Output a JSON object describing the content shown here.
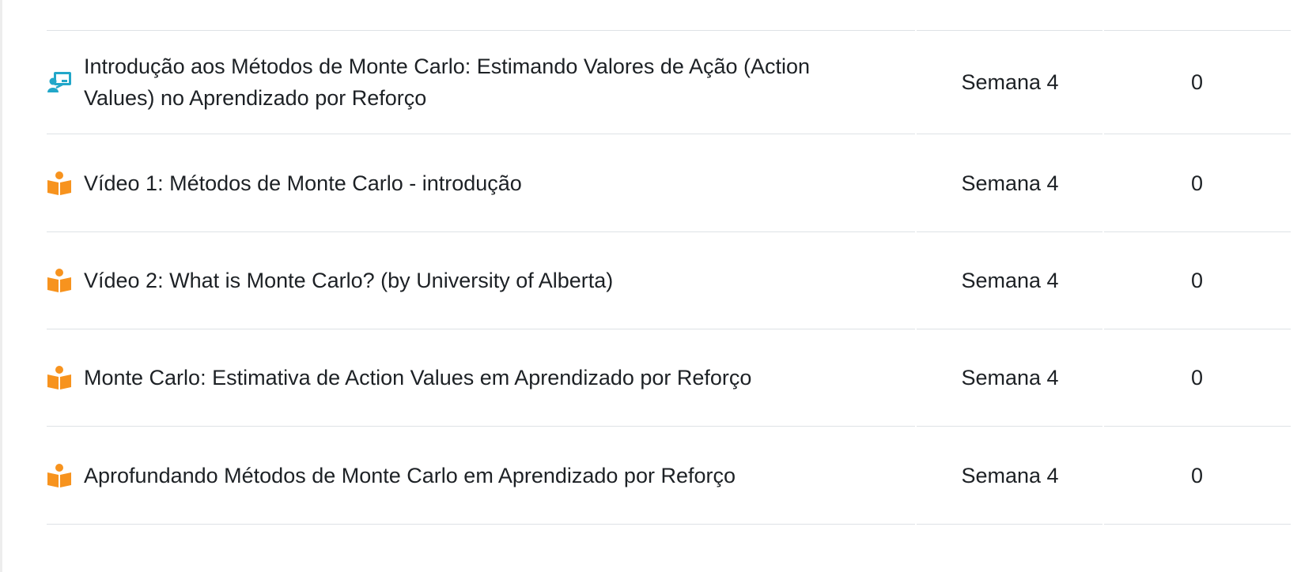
{
  "rows": [
    {
      "icon": "lesson-icon",
      "name": "Introdução aos Métodos de Monte Carlo: Estimando Valores de Ação (Action Values) no Aprendizado por Reforço",
      "section": "Semana 4",
      "count": "0"
    },
    {
      "icon": "book-reader-icon",
      "name": "Vídeo 1: Métodos de Monte Carlo - introdução",
      "section": "Semana 4",
      "count": "0"
    },
    {
      "icon": "book-reader-icon",
      "name": "Vídeo 2: What is Monte Carlo? (by University of Alberta)",
      "section": "Semana 4",
      "count": "0"
    },
    {
      "icon": "book-reader-icon",
      "name": "Monte Carlo: Estimativa de Action Values em Aprendizado por Reforço",
      "section": "Semana 4",
      "count": "0"
    },
    {
      "icon": "book-reader-icon",
      "name": "Aprofundando Métodos de Monte Carlo em Aprendizado por Reforço",
      "section": "Semana 4",
      "count": "0"
    }
  ],
  "colors": {
    "lesson_icon": "#22a7c9",
    "book_icon": "#f7931e",
    "border": "#dee2e6",
    "text": "#1d2125"
  }
}
